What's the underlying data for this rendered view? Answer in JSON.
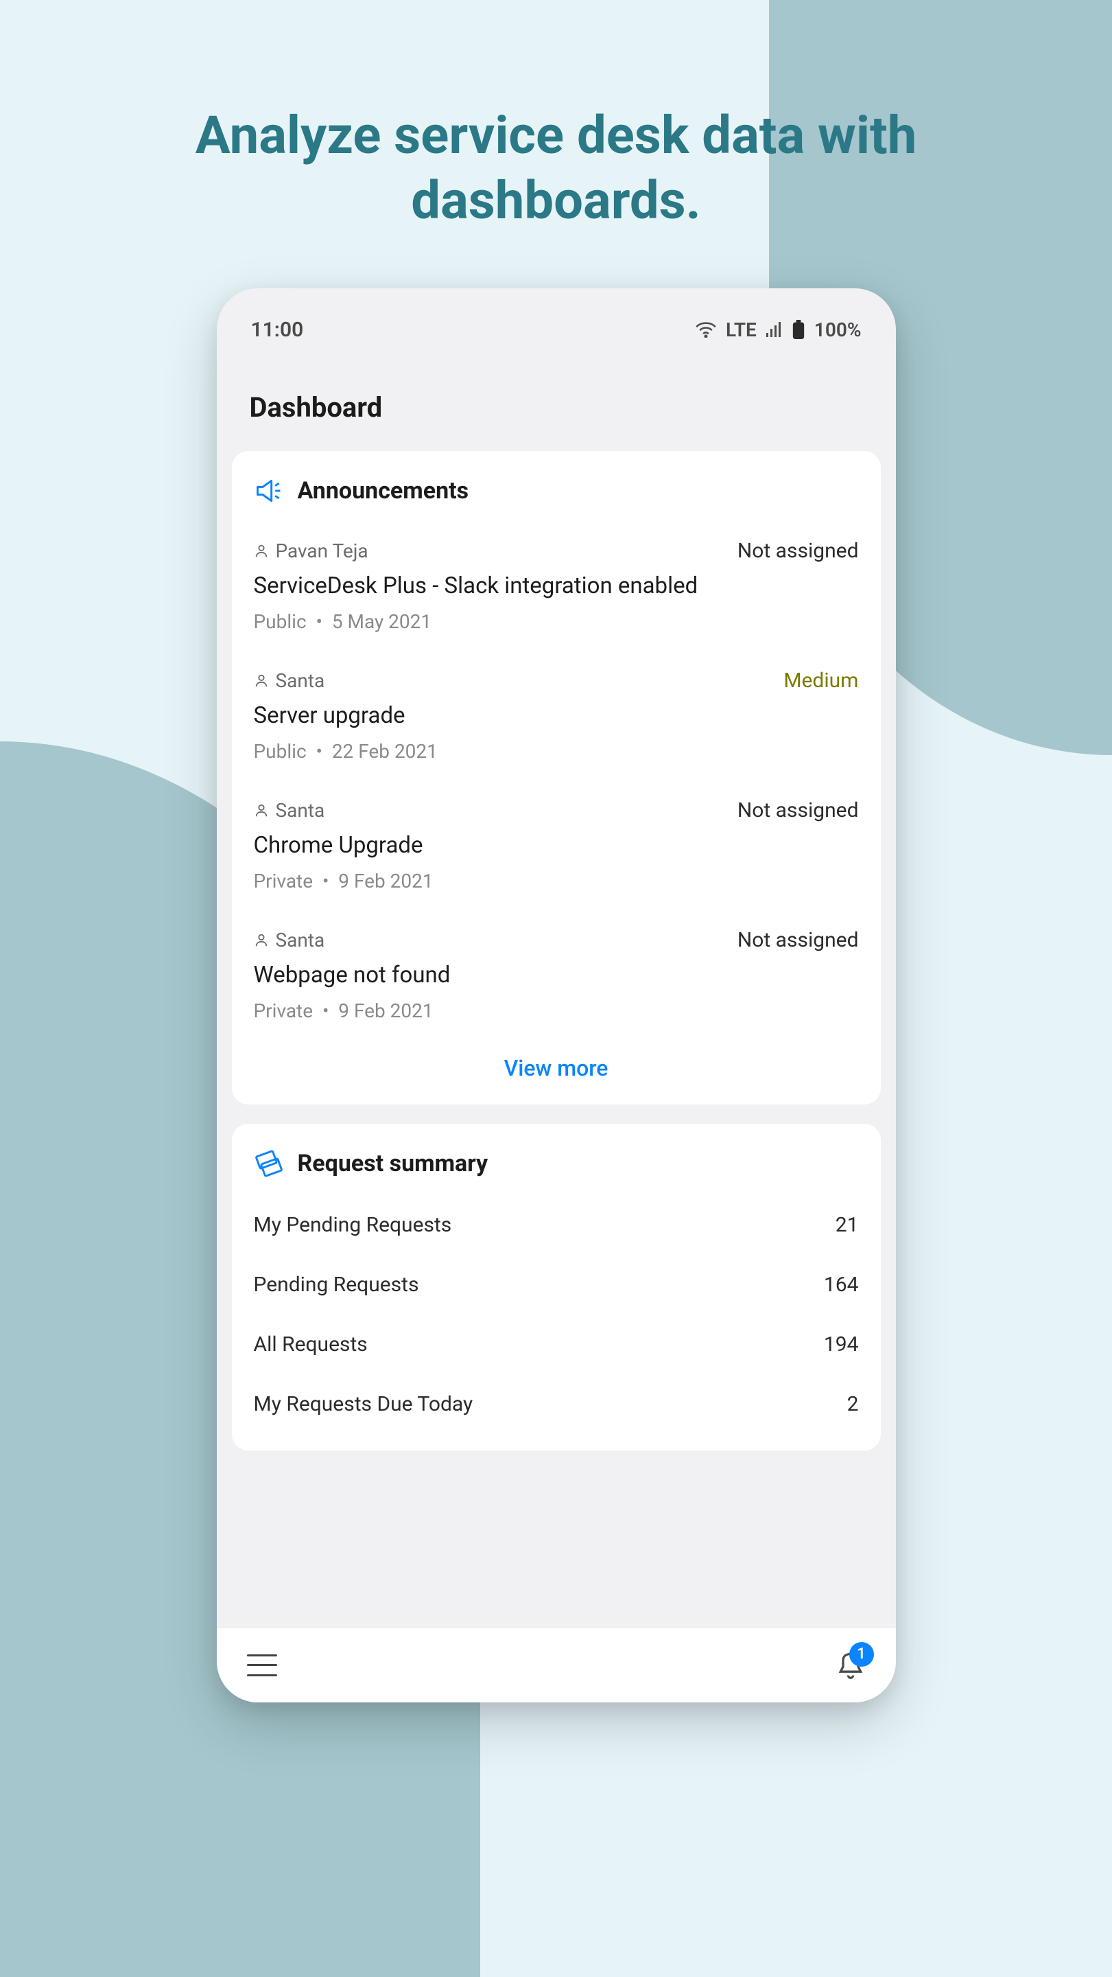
{
  "headline": "Analyze service desk data with dashboards.",
  "statusBar": {
    "time": "11:00",
    "network": "LTE",
    "battery": "100%"
  },
  "pageTitle": "Dashboard",
  "announcements": {
    "title": "Announcements",
    "viewMore": "View more",
    "items": [
      {
        "author": "Pavan Teja",
        "status": "Not assigned",
        "statusClass": "",
        "title": "ServiceDesk Plus - Slack integration enabled",
        "visibility": "Public",
        "date": "5 May 2021"
      },
      {
        "author": "Santa",
        "status": "Medium",
        "statusClass": "medium",
        "title": "Server upgrade",
        "visibility": "Public",
        "date": "22 Feb 2021"
      },
      {
        "author": "Santa",
        "status": "Not assigned",
        "statusClass": "",
        "title": "Chrome Upgrade",
        "visibility": "Private",
        "date": "9 Feb 2021"
      },
      {
        "author": "Santa",
        "status": "Not assigned",
        "statusClass": "",
        "title": "Webpage not found",
        "visibility": "Private",
        "date": "9 Feb 2021"
      }
    ]
  },
  "requestSummary": {
    "title": "Request summary",
    "items": [
      {
        "label": "My Pending Requests",
        "value": "21"
      },
      {
        "label": "Pending Requests",
        "value": "164"
      },
      {
        "label": "All Requests",
        "value": "194"
      },
      {
        "label": "My Requests Due Today",
        "value": "2"
      }
    ]
  },
  "bottomNav": {
    "notificationCount": "1"
  }
}
